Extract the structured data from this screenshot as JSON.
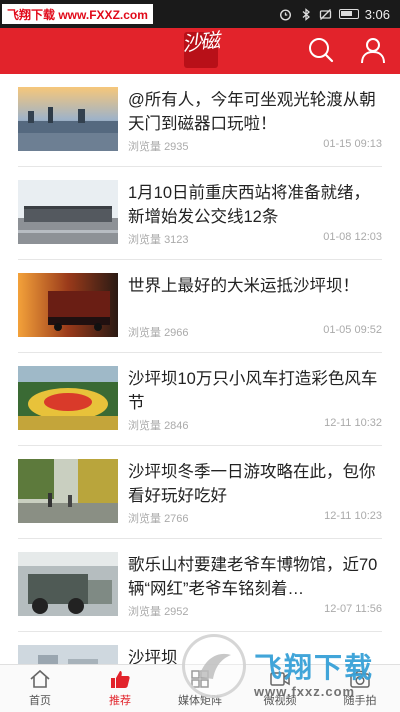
{
  "status_bar": {
    "watermark_text": "飞翔下载 www.FXXZ.com",
    "time": "3:06"
  },
  "header": {
    "logo_text": "沙磁",
    "search_icon": "search-icon",
    "user_icon": "user-icon"
  },
  "news": [
    {
      "title": "@所有人，今年可坐观光轮渡从朝天门到磁器口玩啦！",
      "views_label": "浏览量",
      "views": "2935",
      "date": "01-15 09:13"
    },
    {
      "title": "1月10日前重庆西站将准备就绪，新增始发公交线12条",
      "views_label": "浏览量",
      "views": "3123",
      "date": "01-08 12:03"
    },
    {
      "title": "世界上最好的大米运抵沙坪坝！",
      "views_label": "浏览量",
      "views": "2966",
      "date": "01-05 09:52"
    },
    {
      "title": "沙坪坝10万只小风车打造彩色风车节",
      "views_label": "浏览量",
      "views": "2846",
      "date": "12-11 10:32"
    },
    {
      "title": "沙坪坝冬季一日游攻略在此，包你看好玩好吃好",
      "views_label": "浏览量",
      "views": "2766",
      "date": "12-11 10:23"
    },
    {
      "title": "歌乐山村要建老爷车博物馆，近70辆“网红”老爷车铭刻着…",
      "views_label": "浏览量",
      "views": "2952",
      "date": "12-07 11:56"
    },
    {
      "title": "沙坪坝",
      "views_label": "",
      "views": "",
      "date": ""
    }
  ],
  "bottom_nav": [
    {
      "label": "首页",
      "icon": "home-icon",
      "active": false
    },
    {
      "label": "推荐",
      "icon": "thumbs-up-icon",
      "active": true
    },
    {
      "label": "媒体矩阵",
      "icon": "grid-icon",
      "active": false
    },
    {
      "label": "微视频",
      "icon": "video-icon",
      "active": false
    },
    {
      "label": "随手拍",
      "icon": "camera-icon",
      "active": false
    }
  ],
  "overlay_watermark": {
    "big_text": "飞翔下载",
    "url": "www.fxxz.com"
  },
  "colors": {
    "brand_red": "#e2232b",
    "status_bar": "#1a1a1a",
    "active_nav": "#e2232b"
  }
}
